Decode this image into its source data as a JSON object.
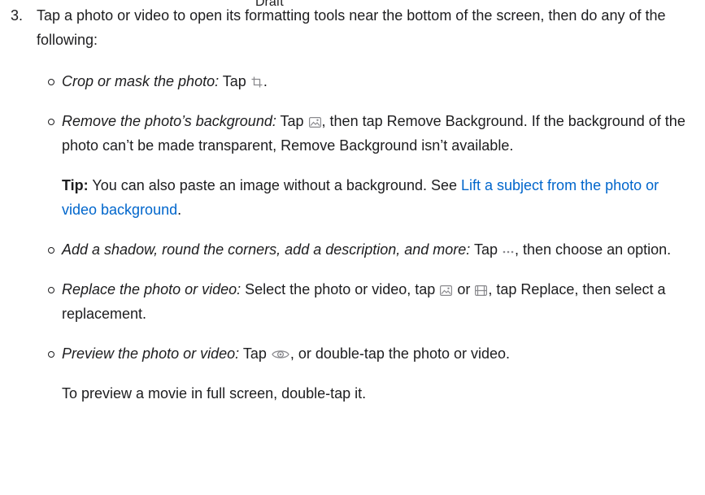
{
  "watermark": "Draft",
  "step": {
    "number": "3.",
    "text": "Tap a photo or video to open its formatting tools near the bottom of the screen, then do any of the following:"
  },
  "items": [
    {
      "label": "Crop or mask the photo:",
      "pre": " Tap ",
      "post": "."
    },
    {
      "label": "Remove the photo’s background:",
      "pre": " Tap ",
      "post": ", then tap Remove Background. If the background of the photo can’t be made transparent, Remove Background isn’t available."
    },
    {
      "label": "Add a shadow, round the corners, add a description, and more:",
      "pre": " Tap ",
      "post": ", then choose an option."
    },
    {
      "label": "Replace the photo or video:",
      "pre": " Select the photo or video, tap ",
      "mid": " or ",
      "post": ", tap Replace, then select a replacement."
    },
    {
      "label": "Preview the photo or video:",
      "pre": " Tap ",
      "post": ", or double-tap the photo or video."
    }
  ],
  "tip": {
    "label": "Tip:",
    "text": " You can also paste an image without a background. See ",
    "link": "Lift a subject from the photo or video background",
    "end": "."
  },
  "closing": "To preview a movie in full screen, double-tap it.",
  "icons": {
    "crop": "crop-icon",
    "photo": "photo-icon",
    "more": "more-icon",
    "film": "film-icon",
    "eye": "eye-icon"
  },
  "colors": {
    "text": "#1d1d1f",
    "link": "#0066cc",
    "icon": "#8a8a8e"
  }
}
